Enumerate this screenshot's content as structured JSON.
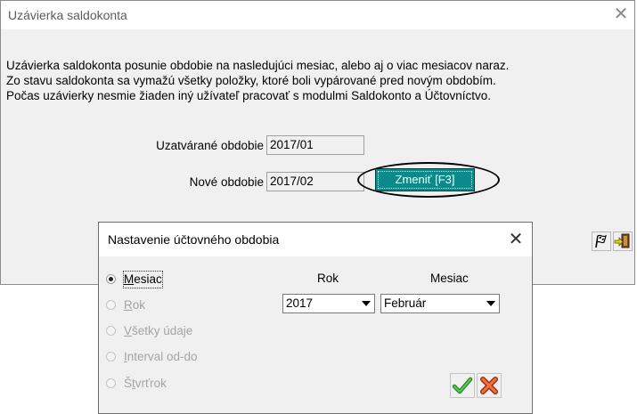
{
  "main_window": {
    "title": "Uzávierka saldokonta",
    "close_glyph": "✕",
    "description": [
      "Uzávierka saldokonta posunie obdobie na nasledujúci mesiac, alebo aj o viac mesiacov naraz.",
      "Zo stavu saldokonta sa vymažú všetky položky, ktoré boli vypárované pred novým obdobím.",
      "Počas uzávierky nesmie žiaden iný užívateľ pracovať s modulmi Saldokonto a Účtovníctvo."
    ],
    "closing_period_label": "Uzatvárané obdobie",
    "closing_period_value": "2017/01",
    "new_period_label": "Nové obdobie",
    "new_period_value": "2017/02",
    "change_button_label": "Zmeniť [F3]",
    "toolbar_icons": [
      "flag-icon",
      "exit-door-icon"
    ],
    "accent_color": "#0a8a8a"
  },
  "dialog": {
    "title": "Nastavenie účtovného obdobia",
    "close_glyph": "✕",
    "options": [
      {
        "prefix": "",
        "accel": "M",
        "rest": "esiac",
        "selected": true,
        "enabled": true
      },
      {
        "prefix": "",
        "accel": "R",
        "rest": "ok",
        "selected": false,
        "enabled": false
      },
      {
        "prefix": "",
        "accel": "V",
        "rest": "šetky údaje",
        "selected": false,
        "enabled": false
      },
      {
        "prefix": "",
        "accel": "I",
        "rest": "nterval od-do",
        "selected": false,
        "enabled": false
      },
      {
        "prefix": "Š",
        "accel": "t",
        "rest": "vrťrok",
        "selected": false,
        "enabled": false
      }
    ],
    "year_header": "Rok",
    "month_header": "Mesiac",
    "year_value": "2017",
    "month_value": "Február",
    "action_icons": [
      "checkmark-icon",
      "cancel-x-icon"
    ]
  }
}
